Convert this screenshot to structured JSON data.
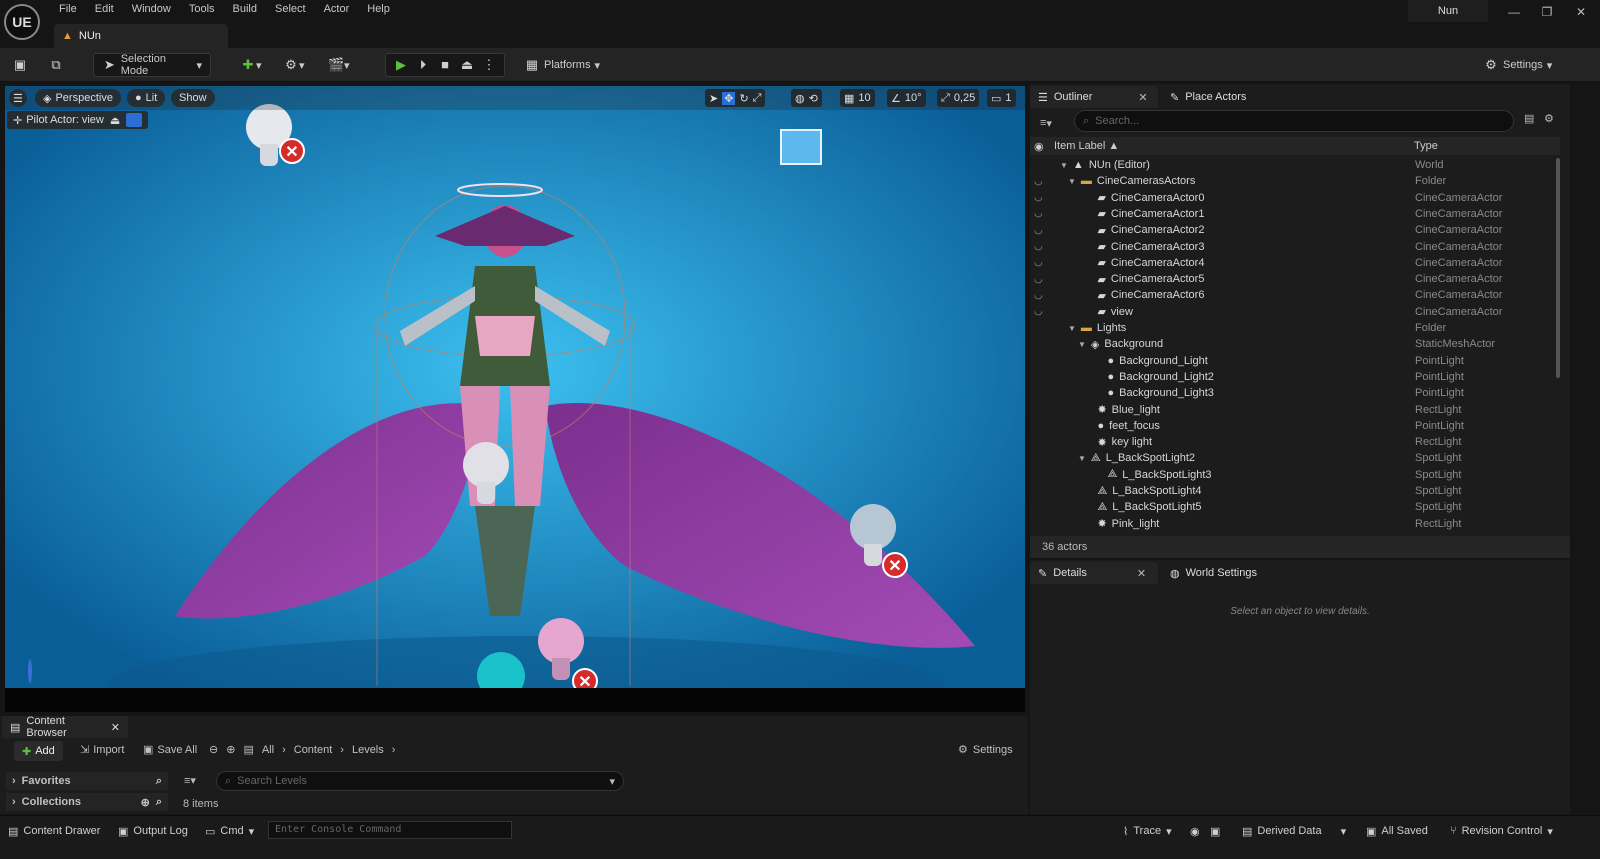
{
  "app": {
    "logo": "UE",
    "menu": [
      "File",
      "Edit",
      "Window",
      "Tools",
      "Build",
      "Select",
      "Actor",
      "Help"
    ],
    "project_name": "Nun",
    "level_tab": "NUn"
  },
  "toolbar": {
    "selection_mode": "Selection Mode",
    "platforms": "Platforms",
    "settings": "Settings"
  },
  "viewport": {
    "perspective": "Perspective",
    "lit": "Lit",
    "show": "Show",
    "pilot": "Pilot Actor: view",
    "grid": "10",
    "angle": "10°",
    "scale": "0,25",
    "camera_speed": "1"
  },
  "outliner": {
    "tab": "Outliner",
    "place_actors": "Place Actors",
    "search_placeholder": "Search...",
    "col_label": "Item Label ▲",
    "col_type": "Type",
    "rows": [
      {
        "label": "NUn (Editor)",
        "type": "World"
      },
      {
        "label": "CineCamerasActors",
        "type": "Folder"
      },
      {
        "label": "CineCameraActor0",
        "type": "CineCameraActor"
      },
      {
        "label": "CineCameraActor1",
        "type": "CineCameraActor"
      },
      {
        "label": "CineCameraActor2",
        "type": "CineCameraActor"
      },
      {
        "label": "CineCameraActor3",
        "type": "CineCameraActor"
      },
      {
        "label": "CineCameraActor4",
        "type": "CineCameraActor"
      },
      {
        "label": "CineCameraActor5",
        "type": "CineCameraActor"
      },
      {
        "label": "CineCameraActor6",
        "type": "CineCameraActor"
      },
      {
        "label": "view",
        "type": "CineCameraActor"
      },
      {
        "label": "Lights",
        "type": "Folder"
      },
      {
        "label": "Background",
        "type": "StaticMeshActor"
      },
      {
        "label": "Background_Light",
        "type": "PointLight"
      },
      {
        "label": "Background_Light2",
        "type": "PointLight"
      },
      {
        "label": "Background_Light3",
        "type": "PointLight"
      },
      {
        "label": "Blue_light",
        "type": "RectLight"
      },
      {
        "label": "feet_focus",
        "type": "PointLight"
      },
      {
        "label": "key light",
        "type": "RectLight"
      },
      {
        "label": "L_BackSpotLight2",
        "type": "SpotLight"
      },
      {
        "label": "L_BackSpotLight3",
        "type": "SpotLight"
      },
      {
        "label": "L_BackSpotLight4",
        "type": "SpotLight"
      },
      {
        "label": "L_BackSpotLight5",
        "type": "SpotLight"
      },
      {
        "label": "Pink_light",
        "type": "RectLight"
      }
    ],
    "actor_count": "36 actors"
  },
  "details": {
    "tab": "Details",
    "world_settings": "World Settings",
    "empty_msg": "Select an object to view details."
  },
  "content_browser": {
    "tab": "Content Browser",
    "add": "Add",
    "import": "Import",
    "save_all": "Save All",
    "path": [
      "All",
      "Content",
      "Levels"
    ],
    "settings": "Settings",
    "favorites": "Favorites",
    "collections": "Collections",
    "search_placeholder": "Search Levels",
    "item_count": "8 items"
  },
  "statusbar": {
    "content_drawer": "Content Drawer",
    "output_log": "Output Log",
    "cmd": "Cmd",
    "console_placeholder": "Enter Console Command",
    "trace": "Trace",
    "derived_data": "Derived Data",
    "all_saved": "All Saved",
    "revision_control": "Revision Control"
  }
}
